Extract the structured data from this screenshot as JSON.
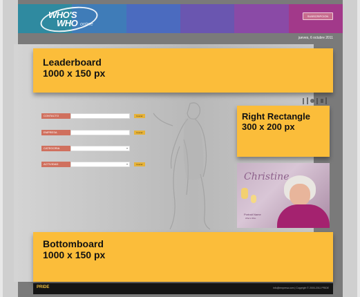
{
  "header": {
    "logo_line1": "WHO'S",
    "logo_line2": "WHO",
    "logo_line3": "online",
    "colors": [
      "#2f8aa0",
      "#3f7cb8",
      "#4b6bbf",
      "#6a56b0",
      "#8a4aa6",
      "#a2398a"
    ],
    "button_label": "SUBSCRIPCION"
  },
  "date_text": "jueves, 6 octubre 2011",
  "ads": {
    "leaderboard": {
      "title": "Leaderboard",
      "size": "1000 x 150 px"
    },
    "right_rectangle": {
      "title": "Right Rectangle",
      "size": "300 x 200 px"
    },
    "bottomboard": {
      "title": "Bottomboard",
      "size": "1000 x 150 px"
    }
  },
  "search_form": {
    "rows": [
      {
        "label": "CONTACTO",
        "value": "",
        "button": "buscar",
        "type": "text"
      },
      {
        "label": "EMPRESA",
        "value": "",
        "button": "buscar",
        "type": "text"
      },
      {
        "label": "CATEGORIA",
        "value": "",
        "button": "",
        "type": "select"
      },
      {
        "label": "ACTIVIDAD",
        "value": "",
        "button": "buscar",
        "type": "select"
      }
    ]
  },
  "promo": {
    "script_title": "Christine",
    "caption1": "Portrait Name",
    "caption2": "Who's Who"
  },
  "footer": {
    "brand": "PRIDE",
    "copyright": "info@empresa.com | Copyright © 2000-2011 PRIDE"
  },
  "colors": {
    "ad_yellow": "#fbbd3a",
    "label_red": "#d0705e",
    "button_yellow": "#e6b23a"
  }
}
